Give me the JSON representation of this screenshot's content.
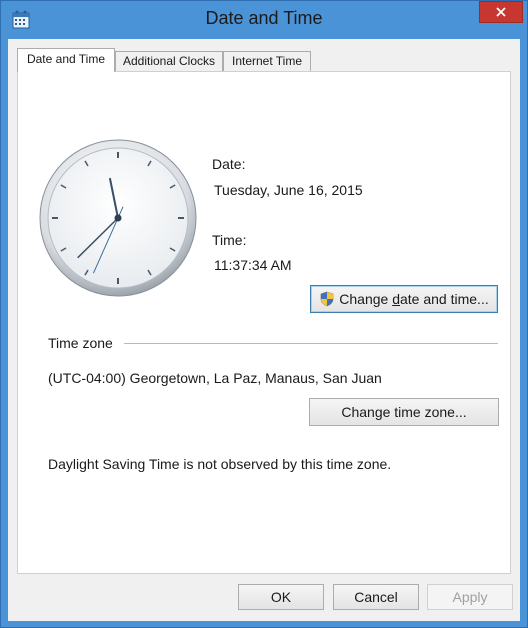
{
  "window": {
    "title": "Date and Time"
  },
  "tabs": [
    {
      "label": "Date and Time",
      "active": true
    },
    {
      "label": "Additional Clocks",
      "active": false
    },
    {
      "label": "Internet Time",
      "active": false
    }
  ],
  "clock": {
    "hour": 11,
    "minute": 37,
    "second": 34
  },
  "date": {
    "label": "Date:",
    "value": "Tuesday, June 16, 2015"
  },
  "time": {
    "label": "Time:",
    "value": "11:37:34 AM"
  },
  "buttons": {
    "change_datetime_prefix": "Change ",
    "change_datetime_accel": "d",
    "change_datetime_suffix": "ate and time...",
    "change_timezone": "Change time zone...",
    "ok": "OK",
    "cancel": "Cancel",
    "apply": "Apply"
  },
  "timezone": {
    "heading": "Time zone",
    "value": "(UTC-04:00) Georgetown, La Paz, Manaus, San Juan",
    "dst_note": "Daylight Saving Time is not observed by this time zone."
  },
  "colors": {
    "titlebar": "#4a93d6",
    "close": "#c7372f"
  }
}
